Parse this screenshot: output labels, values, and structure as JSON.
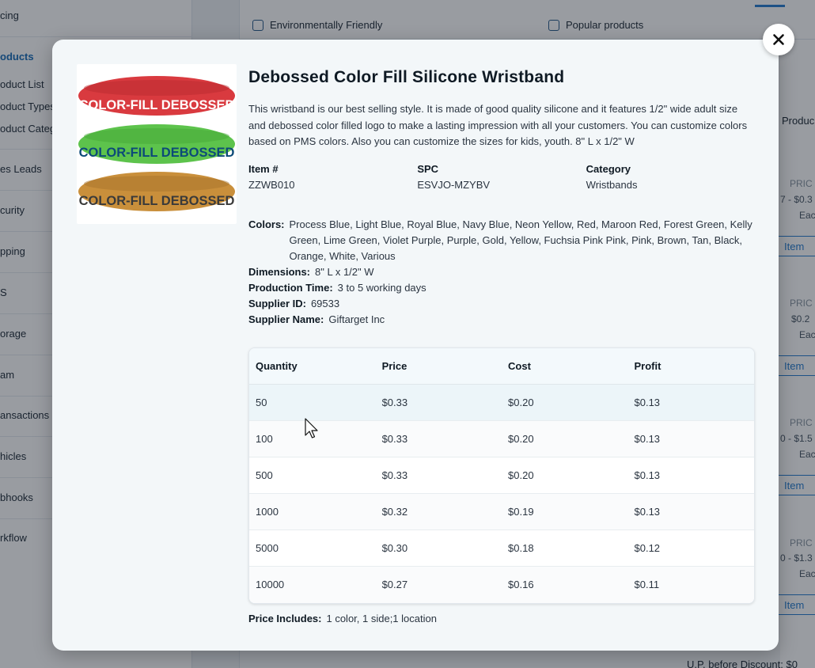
{
  "background": {
    "sidebar_items": [
      {
        "label": "cing",
        "active": false
      },
      {
        "label": "oducts",
        "active": true
      },
      {
        "label": "oduct List",
        "active": false
      },
      {
        "label": "oduct Types",
        "active": false
      },
      {
        "label": "oduct Categ",
        "active": false
      },
      {
        "label": "es Leads",
        "active": false
      },
      {
        "label": "curity",
        "active": false
      },
      {
        "label": "pping",
        "active": false
      },
      {
        "label": "S",
        "active": false
      },
      {
        "label": "orage",
        "active": false
      },
      {
        "label": "am",
        "active": false
      },
      {
        "label": "ansactions",
        "active": false
      },
      {
        "label": "hicles",
        "active": false
      },
      {
        "label": "bhooks",
        "active": false
      },
      {
        "label": "rkflow",
        "active": false
      }
    ],
    "filters": {
      "eco": "Environmentally Friendly",
      "popular": "Popular products"
    },
    "right_column": {
      "header": "Produc",
      "price_label_1": "PRIC",
      "price_range_1": "7 - $0.3",
      "each_1": "Eac",
      "add_btn_1": "Item",
      "price_label_2": "PRIC",
      "price_range_2": "$0.2",
      "each_2": "Eac",
      "add_btn_2": "Item",
      "price_label_3": "PRIC",
      "price_range_3": "0 - $1.5",
      "each_3": "Eac",
      "add_btn_3": "Item",
      "price_label_4": "PRIC",
      "price_range_4": "0 - $1.3",
      "each_4": "Eac",
      "add_btn_4": "Item"
    },
    "footer_text": "U.P. before Discount:   $0"
  },
  "product": {
    "image_bands": [
      {
        "text": "COLOR-FILL DEBOSSED",
        "color": "#d93a3f",
        "text_color": "#ffffff"
      },
      {
        "text": "COLOR-FILL DEBOSSED",
        "color": "#5dc34c",
        "text_color": "#0c4a78"
      },
      {
        "text": "COLOR-FILL DEBOSSED",
        "color": "#c98f3b",
        "text_color": "#3a3a3a"
      }
    ],
    "title": "Debossed Color Fill Silicone Wristband",
    "description": "This wristband is our best selling style. It is made of good quality silicone and it features 1/2\" wide adult size and debossed color filled logo to make a lasting impression with all your customers. You can customize colors based on PMS colors. Also you can customize the sizes for kids, youth. 8\" L x 1/2\" W",
    "meta": {
      "item_label": "Item #",
      "item_value": "ZZWB010",
      "spc_label": "SPC",
      "spc_value": "ESVJO-MZYBV",
      "category_label": "Category",
      "category_value": "Wristbands"
    },
    "specs": {
      "colors_label": "Colors:",
      "colors_value": "Process Blue, Light Blue, Royal Blue, Navy Blue, Neon Yellow, Red, Maroon Red, Forest Green, Kelly Green, Lime Green, Violet Purple, Purple, Gold, Yellow, Fuchsia Pink Pink, Pink, Brown, Tan, Black, Orange, White, Various",
      "dimensions_label": "Dimensions:",
      "dimensions_value": "8\" L x 1/2\" W",
      "production_label": "Production Time:",
      "production_value": "3 to 5 working days",
      "supplier_id_label": "Supplier ID:",
      "supplier_id_value": "69533",
      "supplier_name_label": "Supplier Name:",
      "supplier_name_value": "Giftarget Inc"
    },
    "price_table": {
      "headers": [
        "Quantity",
        "Price",
        "Cost",
        "Profit"
      ],
      "rows": [
        [
          "50",
          "$0.33",
          "$0.20",
          "$0.13"
        ],
        [
          "100",
          "$0.33",
          "$0.20",
          "$0.13"
        ],
        [
          "500",
          "$0.33",
          "$0.20",
          "$0.13"
        ],
        [
          "1000",
          "$0.32",
          "$0.19",
          "$0.13"
        ],
        [
          "5000",
          "$0.30",
          "$0.18",
          "$0.12"
        ],
        [
          "10000",
          "$0.27",
          "$0.16",
          "$0.11"
        ]
      ]
    },
    "price_includes_label": "Price Includes:",
    "price_includes_value": "1 color, 1 side;1 location"
  },
  "close_icon": "close-x-icon"
}
